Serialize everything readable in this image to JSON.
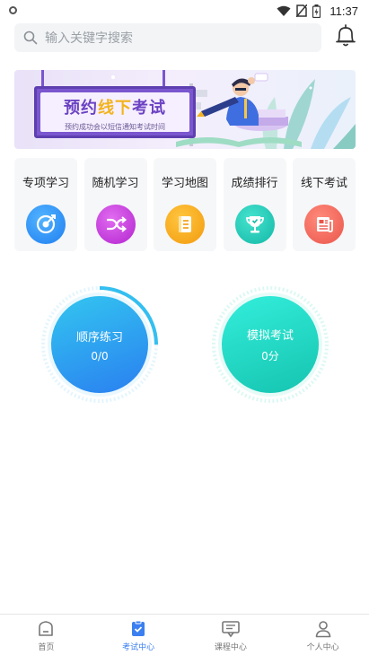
{
  "status_bar": {
    "time": "11:37",
    "icons": [
      "wifi-icon",
      "no-sim-icon",
      "battery-icon"
    ]
  },
  "search": {
    "placeholder": "输入关键字搜索"
  },
  "banner": {
    "title_part1": "预约",
    "title_highlight": "线下",
    "title_part2": "考试",
    "subtitle": "预约成功会以短信通知考试时间"
  },
  "categories": [
    {
      "label": "专项学习",
      "icon": "target-icon",
      "color": "#2f8cf2"
    },
    {
      "label": "随机学习",
      "icon": "shuffle-icon",
      "color": "#c23fd9"
    },
    {
      "label": "学习地图",
      "icon": "book-icon",
      "color": "#f5a314"
    },
    {
      "label": "成绩排行",
      "icon": "trophy-icon",
      "color": "#1fc8b5"
    },
    {
      "label": "线下考试",
      "icon": "newspaper-icon",
      "color": "#f0665a"
    }
  ],
  "practice": {
    "sequential": {
      "title": "顺序练习",
      "value": "0/0"
    },
    "mock": {
      "title": "模拟考试",
      "value": "0分"
    }
  },
  "bottom_nav": [
    {
      "label": "首页",
      "icon": "home-icon",
      "active": false
    },
    {
      "label": "考试中心",
      "icon": "exam-icon",
      "active": true
    },
    {
      "label": "课程中心",
      "icon": "course-icon",
      "active": false
    },
    {
      "label": "个人中心",
      "icon": "person-icon",
      "active": false
    }
  ],
  "colors": {
    "accent": "#3b7ff0",
    "sequential_gradient": [
      "#33c6f0",
      "#2a7ff0"
    ],
    "mock_gradient": [
      "#2ee8d2",
      "#18c6b3"
    ]
  }
}
